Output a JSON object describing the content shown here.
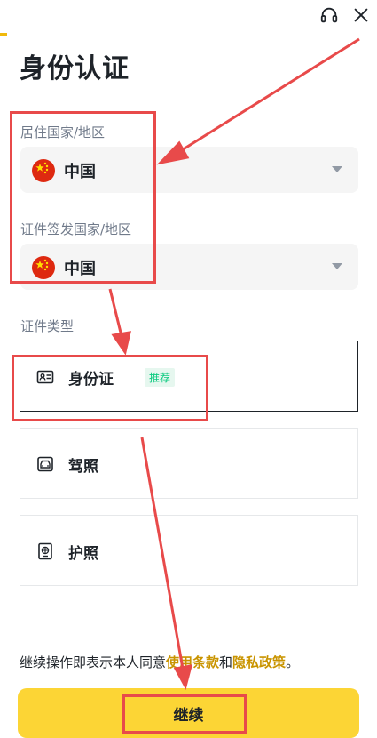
{
  "page": {
    "title": "身份认证",
    "residence_label": "居住国家/地区",
    "residence_value": "中国",
    "issuing_label": "证件签发国家/地区",
    "issuing_value": "中国",
    "doc_type_label": "证件类型",
    "documents": [
      {
        "label": "身份证",
        "badge": "推荐",
        "icon": "id-card-icon",
        "selected": true
      },
      {
        "label": "驾照",
        "icon": "car-icon",
        "selected": false
      },
      {
        "label": "护照",
        "icon": "passport-icon",
        "selected": false
      }
    ],
    "consent": {
      "prefix": "继续操作即表示本人同意",
      "terms": "使用条款",
      "and": "和",
      "privacy": "隐私政策",
      "suffix": "。"
    },
    "continue_label": "继续"
  },
  "header": {
    "icons": [
      "headset-icon",
      "close-icon"
    ]
  },
  "colors": {
    "accent": "#fcd535",
    "link": "#c99400",
    "badge": "#0ecb81",
    "annotation": "#e84a4a"
  }
}
